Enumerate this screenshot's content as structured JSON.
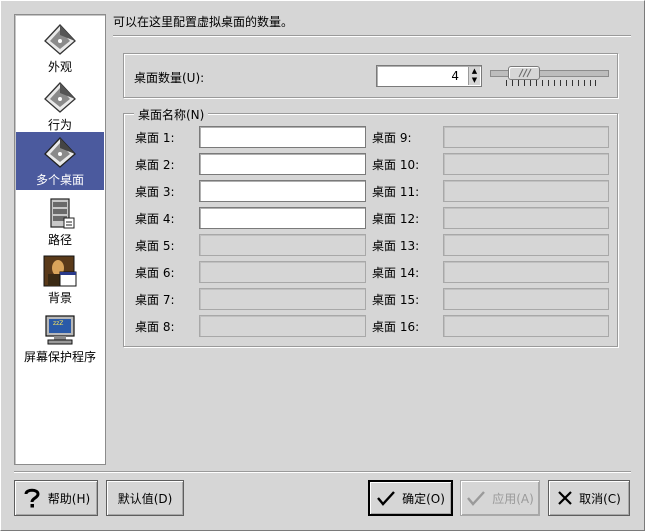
{
  "sidebar": {
    "items": [
      {
        "label": "外观",
        "icon": "appearance-icon"
      },
      {
        "label": "行为",
        "icon": "behavior-icon"
      },
      {
        "label": "多个桌面",
        "icon": "workspaces-icon",
        "selected": true
      },
      {
        "label": "路径",
        "icon": "paths-icon"
      },
      {
        "label": "背景",
        "icon": "background-icon"
      },
      {
        "label": "屏幕保护程序",
        "icon": "screensaver-icon"
      }
    ]
  },
  "instruction": "可以在这里配置虚拟桌面的数量。",
  "count": {
    "label": "桌面数量(U):",
    "value": "4",
    "slider_fraction": 0.2
  },
  "names": {
    "title": "桌面名称(N)",
    "left": [
      {
        "label": "桌面 1:",
        "value": "",
        "enabled": true
      },
      {
        "label": "桌面 2:",
        "value": "",
        "enabled": true
      },
      {
        "label": "桌面 3:",
        "value": "",
        "enabled": true
      },
      {
        "label": "桌面 4:",
        "value": "",
        "enabled": true
      },
      {
        "label": "桌面 5:",
        "value": "",
        "enabled": false
      },
      {
        "label": "桌面 6:",
        "value": "",
        "enabled": false
      },
      {
        "label": "桌面 7:",
        "value": "",
        "enabled": false
      },
      {
        "label": "桌面 8:",
        "value": "",
        "enabled": false
      }
    ],
    "right": [
      {
        "label": "桌面 9:",
        "value": "",
        "enabled": false
      },
      {
        "label": "桌面 10:",
        "value": "",
        "enabled": false
      },
      {
        "label": "桌面 11:",
        "value": "",
        "enabled": false
      },
      {
        "label": "桌面 12:",
        "value": "",
        "enabled": false
      },
      {
        "label": "桌面 13:",
        "value": "",
        "enabled": false
      },
      {
        "label": "桌面 14:",
        "value": "",
        "enabled": false
      },
      {
        "label": "桌面 15:",
        "value": "",
        "enabled": false
      },
      {
        "label": "桌面 16:",
        "value": "",
        "enabled": false
      }
    ]
  },
  "buttons": {
    "help": "帮助(H)",
    "defaults": "默认值(D)",
    "ok": "确定(O)",
    "apply": "应用(A)",
    "cancel": "取消(C)"
  },
  "colors": {
    "selection": "#4b5a9e",
    "background": "#d6d6d6"
  }
}
